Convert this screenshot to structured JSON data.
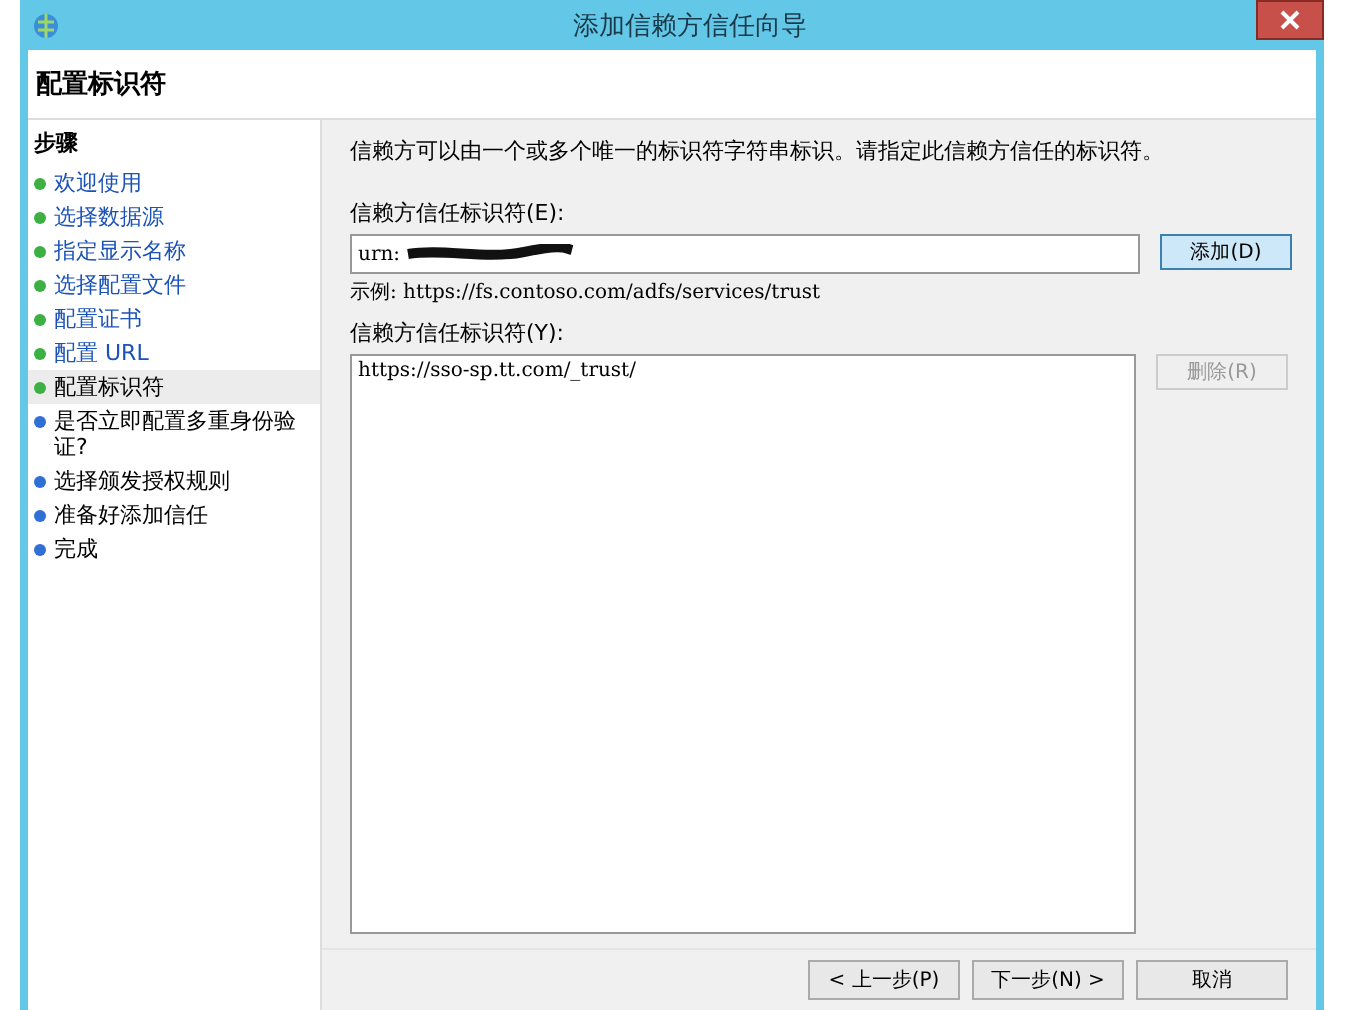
{
  "window": {
    "title": "添加信赖方信任向导"
  },
  "header": {
    "title": "配置标识符"
  },
  "sidebar": {
    "title": "步骤",
    "items": [
      {
        "label": "欢迎使用",
        "color": "#3cb043",
        "selected": false,
        "link": true
      },
      {
        "label": "选择数据源",
        "color": "#3cb043",
        "selected": false,
        "link": true
      },
      {
        "label": "指定显示名称",
        "color": "#3cb043",
        "selected": false,
        "link": true
      },
      {
        "label": "选择配置文件",
        "color": "#3cb043",
        "selected": false,
        "link": true
      },
      {
        "label": "配置证书",
        "color": "#3cb043",
        "selected": false,
        "link": true
      },
      {
        "label": "配置 URL",
        "color": "#3cb043",
        "selected": false,
        "link": true
      },
      {
        "label": "配置标识符",
        "color": "#3cb043",
        "selected": true,
        "link": false
      },
      {
        "label": "是否立即配置多重身份验证?",
        "color": "#2f6fd6",
        "selected": false,
        "link": false
      },
      {
        "label": "选择颁发授权规则",
        "color": "#2f6fd6",
        "selected": false,
        "link": false
      },
      {
        "label": "准备好添加信任",
        "color": "#2f6fd6",
        "selected": false,
        "link": false
      },
      {
        "label": "完成",
        "color": "#2f6fd6",
        "selected": false,
        "link": false
      }
    ]
  },
  "content": {
    "description": "信赖方可以由一个或多个唯一的标识符字符串标识。请指定此信赖方信任的标识符。",
    "identifier_label": "信赖方信任标识符(E):",
    "identifier_value": "urn:",
    "add_button": {
      "label": "添加(D)",
      "disabled": false
    },
    "example": "示例: https://fs.contoso.com/adfs/services/trust",
    "list_label": "信赖方信任标识符(Y):",
    "list_items": [
      "https://sso-sp.tt.com/_trust/"
    ],
    "remove_button": {
      "label": "删除(R)",
      "disabled": true
    }
  },
  "buttons": [
    "< 上一步(P)",
    "下一步(N) >",
    "取消"
  ]
}
